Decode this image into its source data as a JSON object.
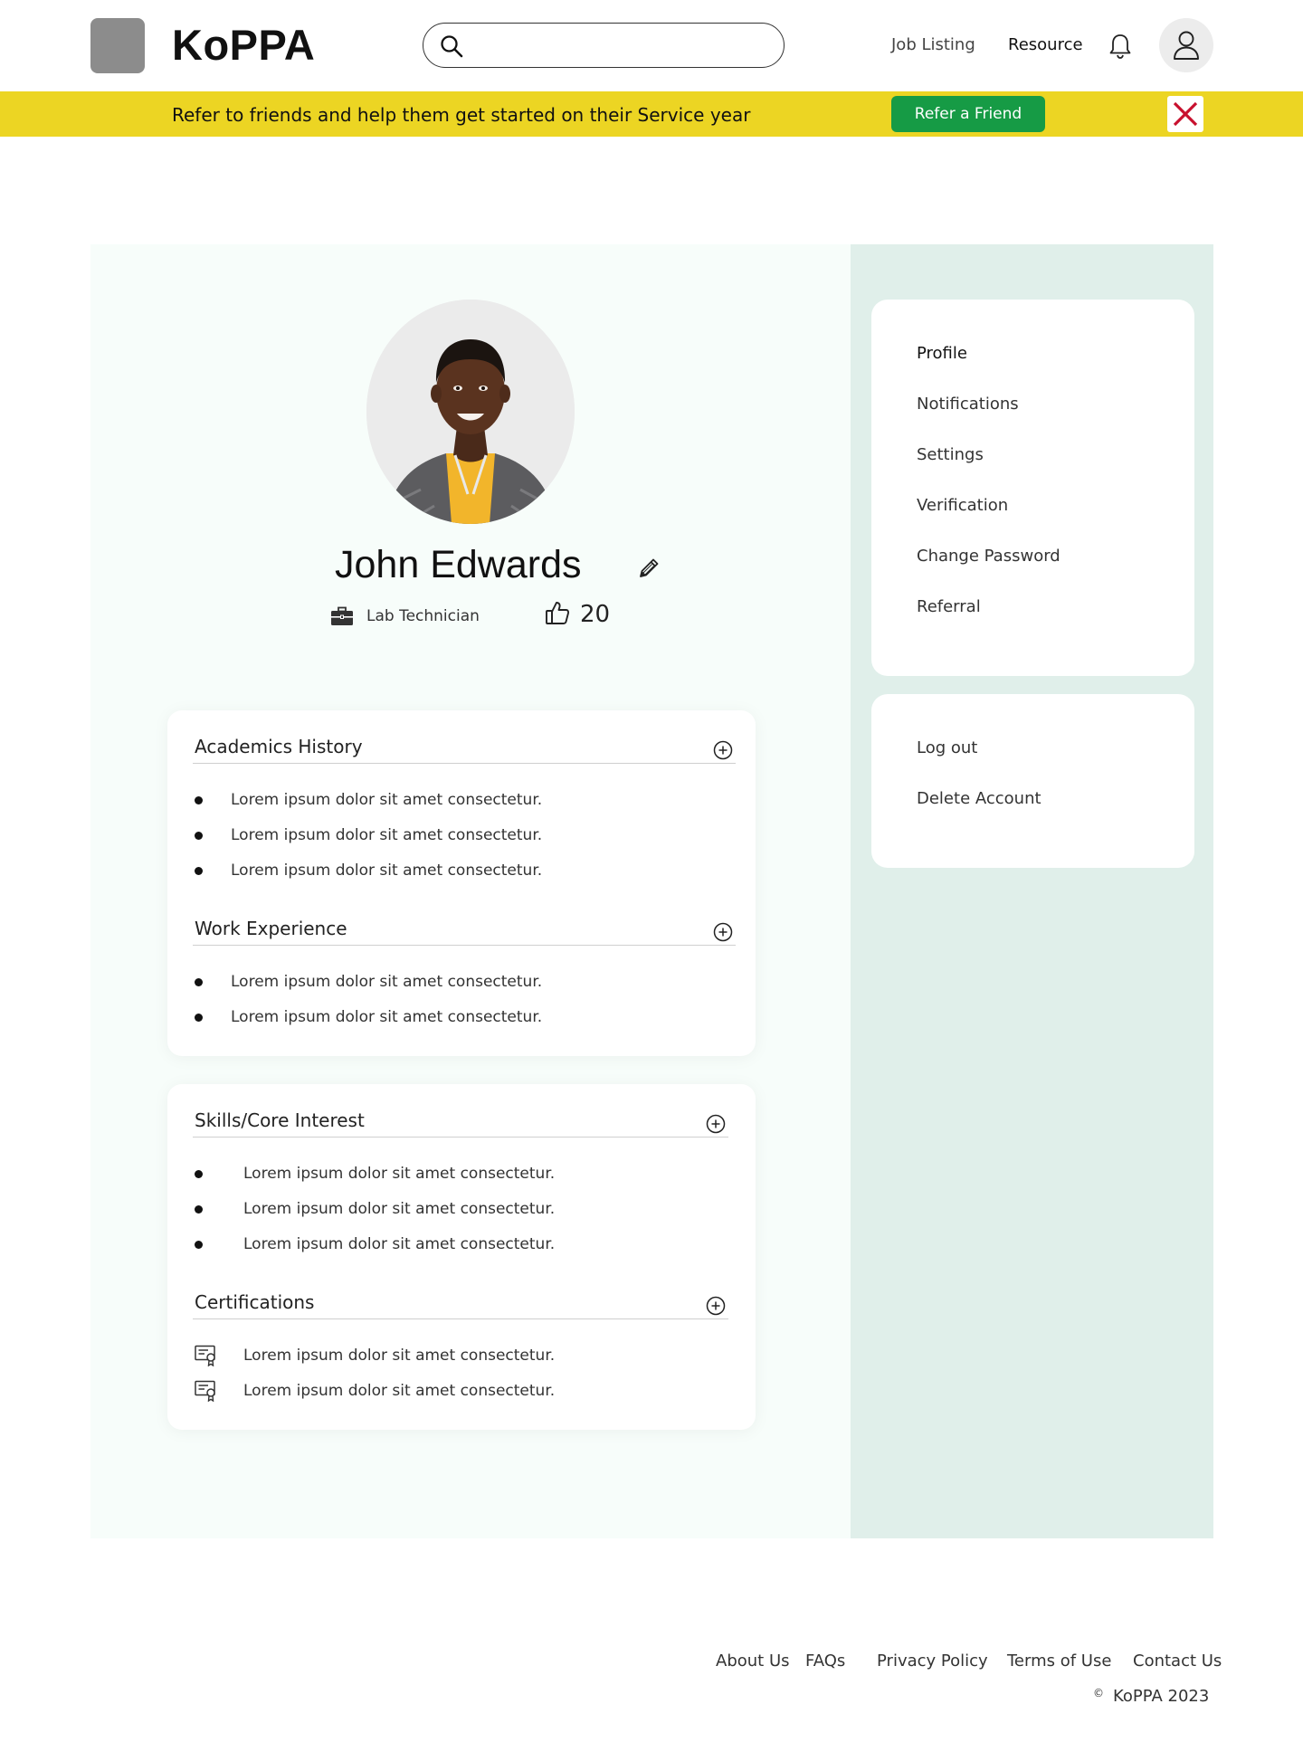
{
  "header": {
    "brand": "KoPPA",
    "search": {
      "value": "",
      "placeholder": ""
    },
    "nav": {
      "job_listing": "Job Listing",
      "resource": "Resource"
    }
  },
  "banner": {
    "text": "Refer to friends and help them get started on their Service year",
    "button": "Refer a Friend"
  },
  "profile": {
    "name": "John Edwards",
    "job_title": "Lab Technician",
    "likes": "20"
  },
  "sections": {
    "academics": {
      "title": "Academics History",
      "items": [
        "Lorem ipsum dolor sit amet consectetur.",
        "Lorem ipsum dolor sit amet consectetur.",
        "Lorem ipsum dolor sit amet consectetur."
      ]
    },
    "work": {
      "title": "Work Experience",
      "items": [
        "Lorem ipsum dolor sit amet consectetur.",
        "Lorem ipsum dolor sit amet consectetur."
      ]
    },
    "skills": {
      "title": "Skills/Core Interest",
      "items": [
        "Lorem ipsum dolor sit amet consectetur.",
        "Lorem ipsum dolor sit amet consectetur.",
        "Lorem ipsum dolor sit amet consectetur."
      ]
    },
    "certifications": {
      "title": "Certifications",
      "items": [
        "Lorem ipsum dolor sit amet consectetur.",
        "Lorem ipsum dolor sit amet consectetur."
      ]
    }
  },
  "menu": {
    "primary": [
      "Profile",
      "Notifications",
      "Settings",
      "Verification",
      "Change Password",
      "Referral"
    ],
    "secondary": [
      "Log out",
      "Delete Account"
    ]
  },
  "footer": {
    "links": [
      "About Us",
      "FAQs",
      "Privacy Policy",
      "Terms of Use",
      "Contact Us"
    ],
    "copyright_symbol": "©",
    "copyright": "KoPPA 2023"
  },
  "colors": {
    "banner": "#ecd523",
    "primary_button": "#169b45",
    "close_icon": "#c8102e",
    "side_panel": "#e0efea",
    "content_panel": "#f7fdfa"
  },
  "icons": [
    "logo-placeholder",
    "search-icon",
    "bell-icon",
    "user-icon",
    "close-icon",
    "pencil-icon",
    "briefcase-icon",
    "thumbs-up-icon",
    "plus-circle-icon",
    "certificate-icon"
  ]
}
